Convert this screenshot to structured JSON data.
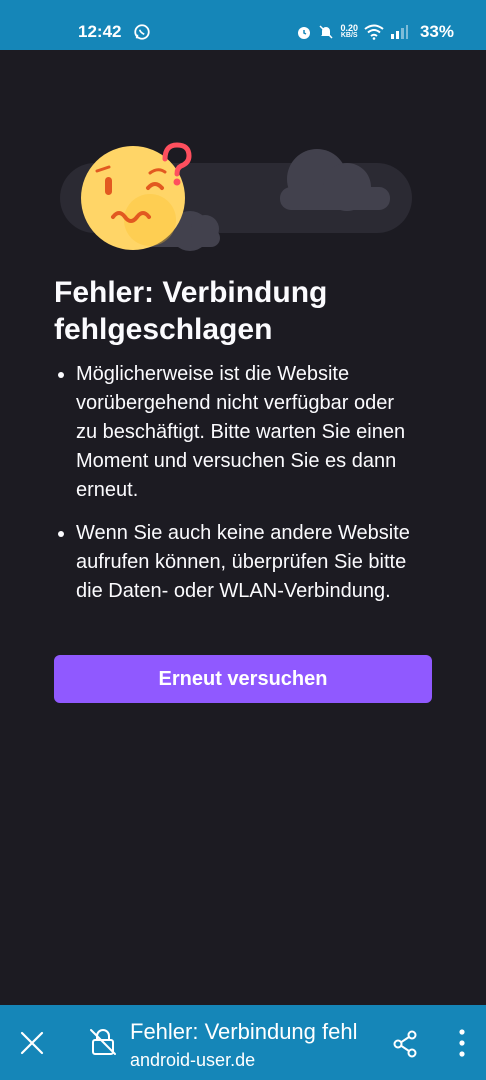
{
  "status_bar": {
    "time": "12:42",
    "network_speed_value": "0.20",
    "network_speed_unit": "KB/S",
    "battery": "33%",
    "icons": [
      "whatsapp-icon",
      "alarm-icon",
      "mute-icon",
      "wifi-icon",
      "signal-icon"
    ]
  },
  "error_page": {
    "title": "Fehler: Verbindung fehlgeschlagen",
    "bullets": [
      "Möglicherweise ist die Website vorübergehend nicht verfügbar oder zu beschäftigt. Bitte warten Sie einen Moment und versuchen Sie es dann erneut.",
      "Wenn Sie auch keine andere Website aufrufen können, überprüfen Sie bitte die Daten- oder WLAN-Verbindung."
    ],
    "retry_label": "Erneut versuchen",
    "illustration": "confused-face-with-clouds"
  },
  "toolbar": {
    "page_title": "Fehler: Verbindung fehlgeschlagen",
    "url": "android-user.de",
    "icons": [
      "close-icon",
      "insecure-lock-icon",
      "share-icon",
      "menu-icon"
    ]
  },
  "colors": {
    "status_bar": "#1586b8",
    "background": "#1c1b22",
    "text": "#fbfbfe",
    "button": "#9059ff",
    "face": "#ffd567",
    "question_mark": "#ff4f5e"
  }
}
